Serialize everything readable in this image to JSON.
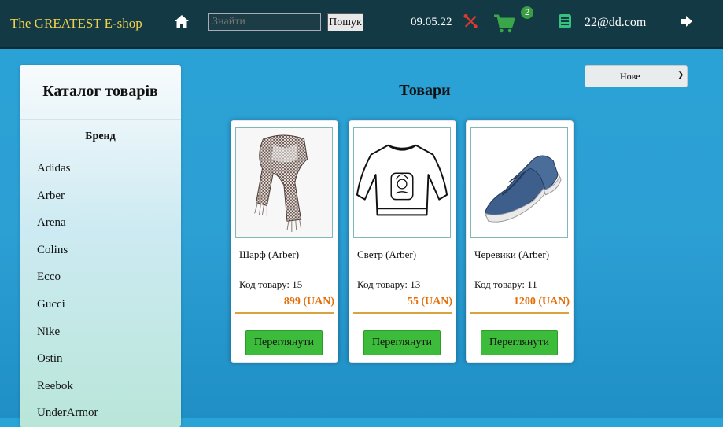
{
  "header": {
    "brand": "The GREATEST E-shop",
    "search_placeholder": "Знайти",
    "search_button": "Пошук",
    "date": "09.05.22",
    "cart_count": "2",
    "email": "22@dd.com",
    "colors": {
      "bar": "#133a44",
      "brand": "#f3d24b",
      "tools": "#e23b2a",
      "cart": "#3aa64a",
      "account": "#35c27e"
    }
  },
  "sidebar": {
    "title": "Каталог товарів",
    "brand_heading": "Бренд",
    "brands": [
      "Adidas",
      "Arber",
      "Arena",
      "Colins",
      "Ecco",
      "Gucci",
      "Nike",
      "Ostin",
      "Reebok",
      "UnderArmor"
    ]
  },
  "main": {
    "title": "Товари",
    "sort": {
      "selected": "Нове"
    },
    "products": [
      {
        "name": "Шарф (Arber)",
        "code_label": "Код товару: 15",
        "price": "899 (UAN)",
        "button": "Переглянути",
        "image": "scarf"
      },
      {
        "name": "Светр (Arber)",
        "code_label": "Код товару: 13",
        "price": "55 (UAN)",
        "button": "Переглянути",
        "image": "sweater"
      },
      {
        "name": "Черевики (Arber)",
        "code_label": "Код товару: 11",
        "price": "1200 (UAN)",
        "button": "Переглянути",
        "image": "shoes"
      }
    ]
  }
}
